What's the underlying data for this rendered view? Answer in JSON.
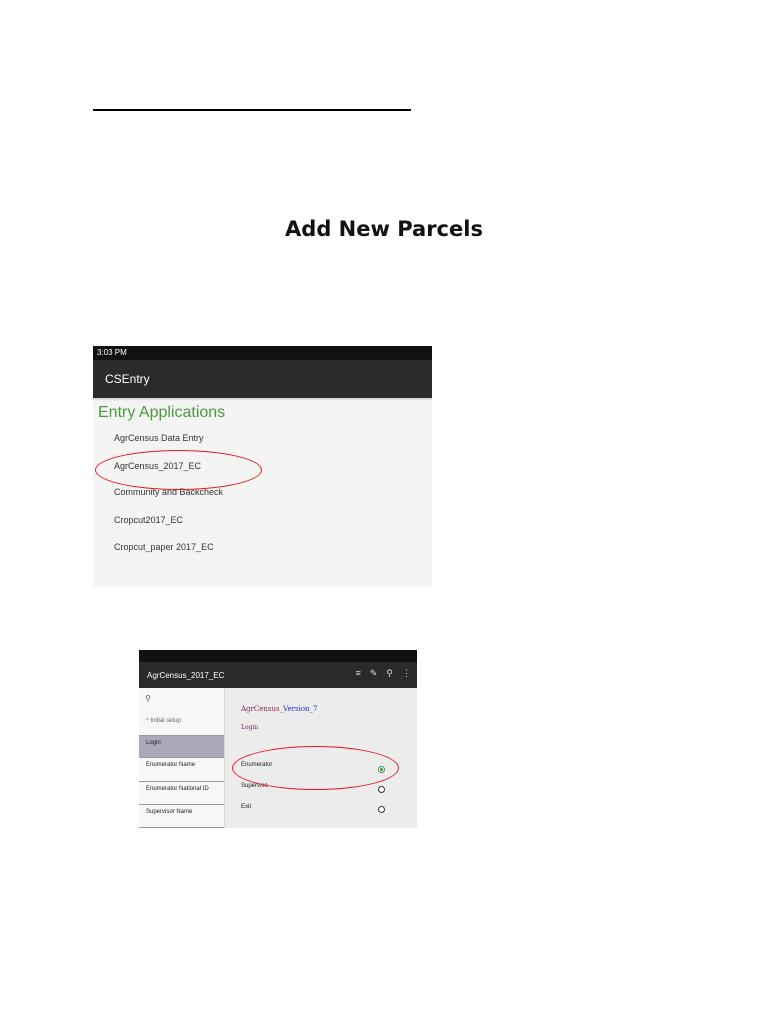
{
  "document": {
    "title": "Add New Parcels"
  },
  "screenshot1": {
    "status_time": "3:03 PM",
    "app_title": "CSEntry",
    "section_heading": "Entry Applications",
    "applications": [
      "AgrCensus Data Entry",
      "AgrCensus_2017_EC",
      "Community and Backcheck",
      "Cropcut2017_EC",
      "Cropcut_paper 2017_EC"
    ],
    "highlighted_item": "AgrCensus_2017_EC",
    "highlight_color": "#e0191f",
    "heading_color": "#4c9a3e"
  },
  "screenshot2": {
    "app_title": "AgrCensus_2017_EC",
    "toolbar_icons": [
      "list-icon",
      "edit-icon",
      "search-icon",
      "overflow-menu-icon"
    ],
    "sidebar": {
      "search_icon": "search-icon",
      "group_label": "^ Initial setup",
      "items": [
        "Login",
        "Enumerator Name",
        "Enumerator National ID",
        "Supervisor Name"
      ],
      "active_item": "Login"
    },
    "form": {
      "version_prefix": "AgrCensus_",
      "version_suffix": "Version_7",
      "field_label": "Login",
      "options": [
        {
          "label": "Enumerator",
          "selected": true
        },
        {
          "label": "Superviso",
          "selected": false
        },
        {
          "label": "Exit",
          "selected": false
        }
      ]
    },
    "highlighted_option": "Enumerator"
  }
}
